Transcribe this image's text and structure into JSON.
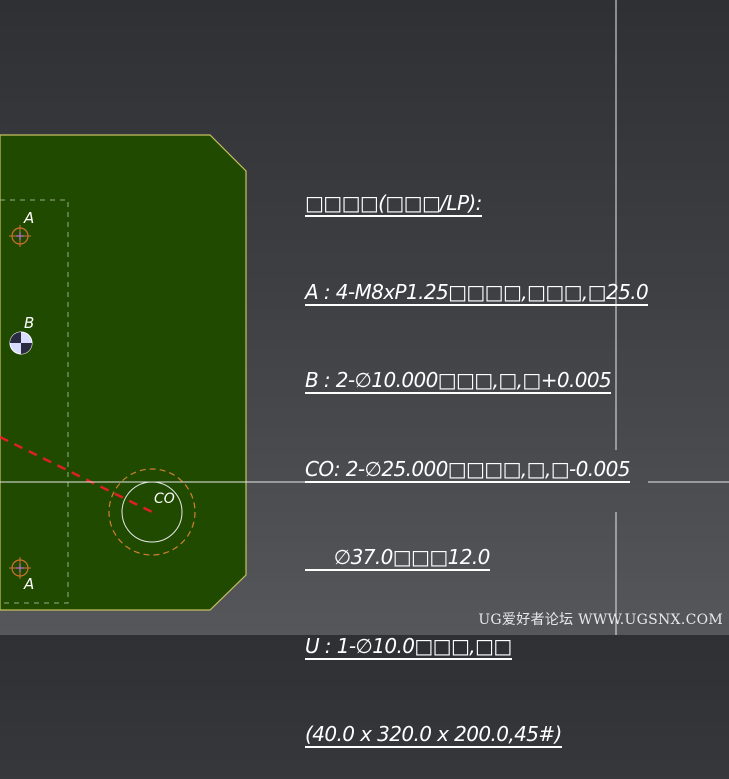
{
  "drawing": {
    "plate_color": "#1f4a00",
    "outline_color": "#c8c060",
    "hole_labels": {
      "a_top": "A",
      "b": "B",
      "a_bottom": "A",
      "co": "CO"
    }
  },
  "note_lines": [
    "□□□□(□□□/LP):",
    "A : 4-M8xP1.25□□□□,□□□,□25.0",
    "B : 2-∅10.000□□□,□,□+0.005",
    "CO: 2-∅25.000□□□□,□,□-0.005",
    "     ∅37.0□□□12.0",
    "U : 1-∅10.0□□□,□□",
    "(40.0 x 320.0 x 200.0,45#)"
  ],
  "watermark": "UG爱好者论坛 WWW.UGSNX.COM"
}
